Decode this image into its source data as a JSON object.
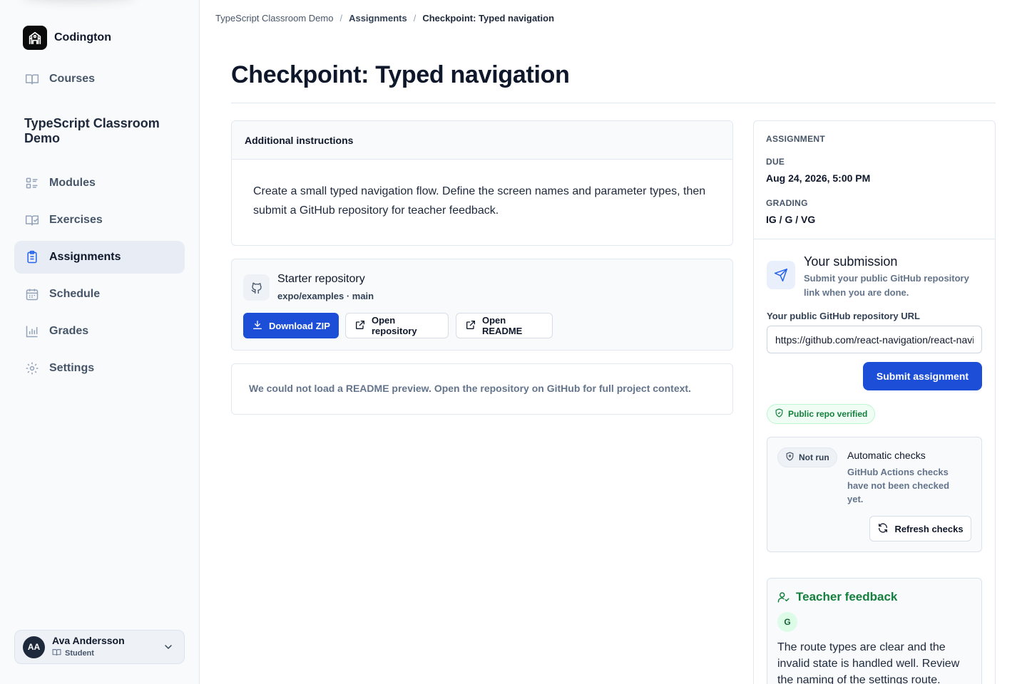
{
  "sidebar": {
    "brand": "Codington",
    "courses_label": "Courses",
    "course_title": "TypeScript Classroom Demo",
    "items": [
      {
        "label": "Modules",
        "icon": "modules-icon"
      },
      {
        "label": "Exercises",
        "icon": "exercises-icon"
      },
      {
        "label": "Assignments",
        "icon": "assignments-icon",
        "active": true
      },
      {
        "label": "Schedule",
        "icon": "calendar-icon"
      },
      {
        "label": "Grades",
        "icon": "bar-chart-icon"
      },
      {
        "label": "Settings",
        "icon": "gear-icon"
      }
    ],
    "user": {
      "initials": "AA",
      "name": "Ava Andersson",
      "role": "Student"
    }
  },
  "breadcrumb": [
    "TypeScript Classroom Demo",
    "Assignments",
    "Checkpoint: Typed navigation"
  ],
  "page": {
    "title": "Checkpoint: Typed navigation"
  },
  "instructions": {
    "heading": "Additional instructions",
    "body": "Create a small typed navigation flow. Define the screen names and parameter types, then submit a GitHub repository for teacher feedback."
  },
  "repo": {
    "title": "Starter repository",
    "subtitle": "expo/examples · main",
    "download_label": "Download ZIP",
    "open_repo_label": "Open repository",
    "open_readme_label": "Open README"
  },
  "readme_notice": "We could not load a README preview. Open the repository on GitHub for full project context.",
  "assignment": {
    "section_label": "ASSIGNMENT",
    "due_label": "DUE",
    "due_value": "Aug 24, 2026, 5:00 PM",
    "grading_label": "GRADING",
    "grading_value": "IG / G / VG"
  },
  "submission": {
    "title": "Your submission",
    "description": "Submit your public GitHub repository link when you are done.",
    "url_label": "Your public GitHub repository URL",
    "url_value": "https://github.com/react-navigation/react-navigation",
    "submit_label": "Submit assignment",
    "verified_label": "Public repo verified"
  },
  "checks": {
    "status": "Not run",
    "title": "Automatic checks",
    "description": "GitHub Actions checks have not been checked yet.",
    "refresh_label": "Refresh checks"
  },
  "feedback": {
    "title": "Teacher feedback",
    "grade": "G",
    "text": "The route types are clear and the invalid state is handled well. Review the naming of the settings route."
  },
  "colors": {
    "accent": "#1d4ed8",
    "success": "#15803d",
    "sidebar_bg": "#f8fafc"
  }
}
